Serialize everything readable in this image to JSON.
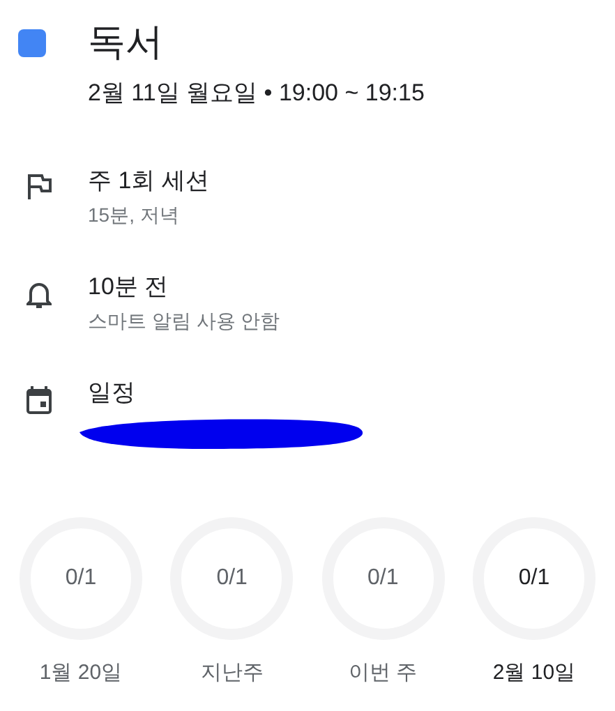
{
  "event": {
    "title": "독서",
    "color": "#4285f4",
    "datetime": "2월 11일 월요일 • 19:00 ~ 19:15"
  },
  "details": [
    {
      "kind": "goal",
      "primary": "주 1회 세션",
      "secondary": "15분, 저녁"
    },
    {
      "kind": "reminder",
      "primary": "10분 전",
      "secondary": "스마트 알림 사용 안함"
    },
    {
      "kind": "calendar",
      "primary": "일정"
    }
  ],
  "progress": [
    {
      "reading": "0/1",
      "label": "1월 20일",
      "selected": false
    },
    {
      "reading": "0/1",
      "label": "지난주",
      "selected": false
    },
    {
      "reading": "0/1",
      "label": "이번 주",
      "selected": false
    },
    {
      "reading": "0/1",
      "label": "2월 10일",
      "selected": true
    }
  ]
}
